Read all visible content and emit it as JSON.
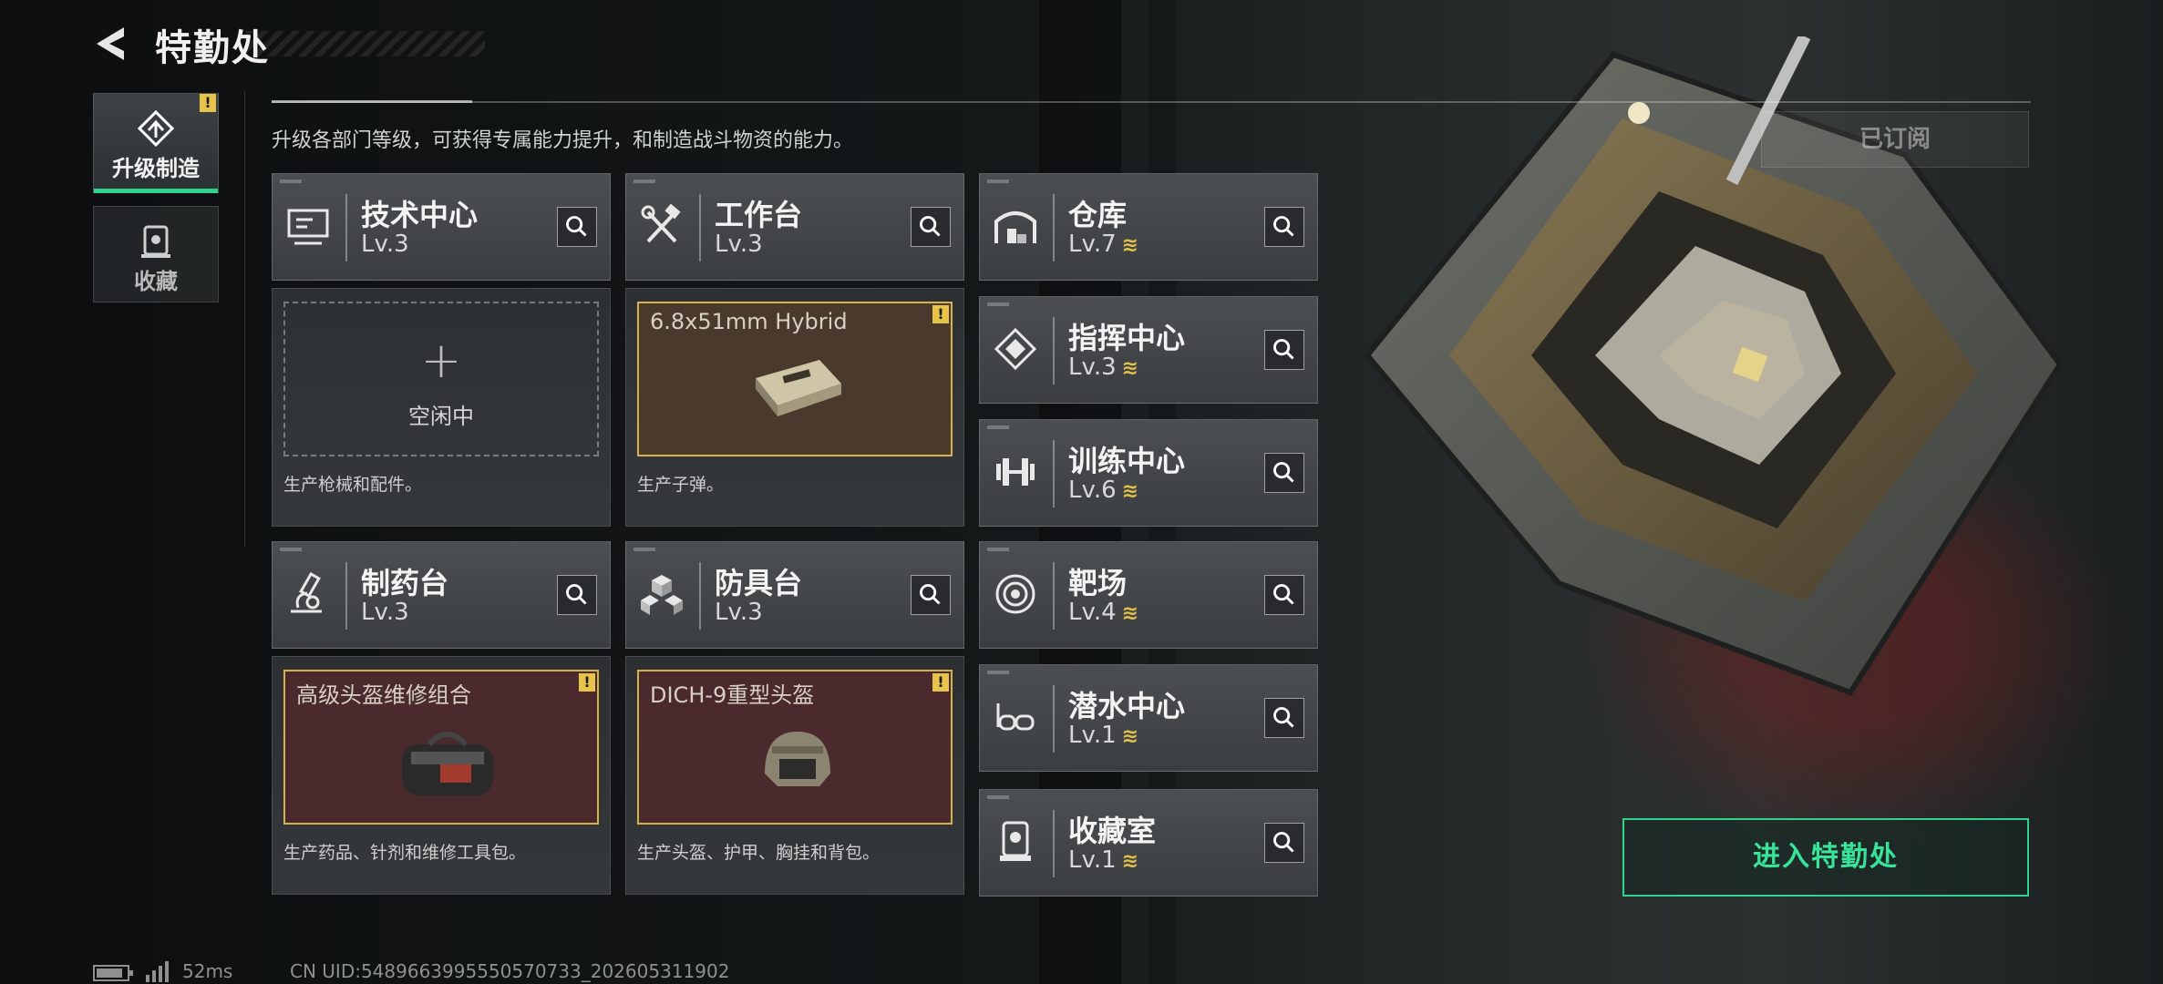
{
  "header": {
    "title": "特勤处"
  },
  "tabs": [
    {
      "label": "升级制造",
      "active": true,
      "icon": "upgrade-icon",
      "warning": "!"
    },
    {
      "label": "收藏",
      "active": false,
      "icon": "collection-icon"
    }
  ],
  "description": "升级各部门等级，可获得专属能力提升，和制造战斗物资的能力。",
  "subscribed_label": "已订阅",
  "enter_button": "进入特勤处",
  "workbenches": [
    {
      "name": "技术中心",
      "level": "Lv.3",
      "icon": "monitor-icon",
      "slot": {
        "state": "empty",
        "plus": "+",
        "label": "空闲中"
      },
      "description": "生产枪械和配件。"
    },
    {
      "name": "工作台",
      "level": "Lv.3",
      "icon": "hammer-wrench-icon",
      "slot": {
        "state": "producing",
        "label": "6.8x51mm Hybrid",
        "warning": "!",
        "item_icon": "ammo-box-icon"
      },
      "description": "生产子弹。"
    },
    {
      "name": "制药台",
      "level": "Lv.3",
      "icon": "microscope-icon",
      "slot": {
        "state": "producing",
        "label": "高级头盔维修组合",
        "warning": "!",
        "item_icon": "repair-bag-icon"
      },
      "description": "生产药品、针剂和维修工具包。"
    },
    {
      "name": "防具台",
      "level": "Lv.3",
      "icon": "cubes-icon",
      "slot": {
        "state": "producing",
        "label": "DICH-9重型头盔",
        "warning": "!",
        "item_icon": "helmet-icon"
      },
      "description": "生产头盔、护甲、胸挂和背包。"
    }
  ],
  "facilities": [
    {
      "name": "仓库",
      "level": "Lv.7",
      "icon": "warehouse-icon",
      "upgradable": true
    },
    {
      "name": "指挥中心",
      "level": "Lv.3",
      "icon": "chip-icon",
      "upgradable": true
    },
    {
      "name": "训练中心",
      "level": "Lv.6",
      "icon": "dumbbell-icon",
      "upgradable": true
    },
    {
      "name": "靶场",
      "level": "Lv.4",
      "icon": "target-icon",
      "upgradable": true
    },
    {
      "name": "潜水中心",
      "level": "Lv.1",
      "icon": "goggles-icon",
      "upgradable": true
    },
    {
      "name": "收藏室",
      "level": "Lv.1",
      "icon": "trophy-case-icon",
      "upgradable": true
    }
  ],
  "upgrade_glyph": "≋",
  "footer": {
    "ping": "52ms",
    "uid": "CN UID:5489663995550570733_202605311902"
  },
  "colors": {
    "accent": "#2fd38e",
    "warning": "#e8c34a",
    "upgrade": "#e2c14a"
  }
}
